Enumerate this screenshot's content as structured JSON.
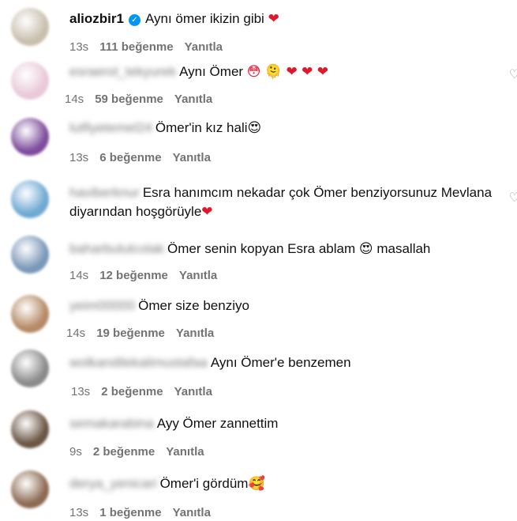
{
  "comments": [
    {
      "username": "aliozbir1",
      "verified": true,
      "blurred": false,
      "text": "Aynı ömer ikizin gibi",
      "emoji": "❤",
      "time": "13s",
      "likes": "111 beğenme",
      "reply": "Yanıtla",
      "avatar_color": "#c9bfae"
    },
    {
      "username": "esraerol_tekyurek",
      "verified": false,
      "blurred": true,
      "text": "Aynı Ömer",
      "emoji": "😳 🫠 ❤ ❤ ❤",
      "time": "14s",
      "likes": "59 beğenme",
      "reply": "Yanıtla",
      "avatar_color": "#e9c9d8"
    },
    {
      "username": "lutfiyetemel24",
      "verified": false,
      "blurred": true,
      "text": "Ömer'in kız hali",
      "emoji": "😍",
      "time": "13s",
      "likes": "6 beğenme",
      "reply": "Yanıtla",
      "avatar_color": "#7d4d9c"
    },
    {
      "username": "haviberknur",
      "verified": false,
      "blurred": true,
      "text": "Esra hanımcım nekadar çok Ömer benziyorsunuz Mevlana diyarından hoşgörüyle",
      "emoji": "❤",
      "time": "",
      "likes": "",
      "reply": "",
      "avatar_color": "#6fa9d3"
    },
    {
      "username": "baharbulutcolak",
      "verified": false,
      "blurred": true,
      "text": "Ömer senin kopyan Esra ablam",
      "emoji": "😍",
      "text2": "masallah",
      "time": "14s",
      "likes": "12 beğenme",
      "reply": "Yanıtla",
      "avatar_color": "#7a98b8"
    },
    {
      "username": "yeim00000",
      "verified": false,
      "blurred": true,
      "text": "Ömer size benziyo",
      "emoji": "",
      "time": "14s",
      "likes": "19 beğenme",
      "reply": "Yanıtla",
      "avatar_color": "#b58a66"
    },
    {
      "username": "wolkandilekalimustafaa",
      "verified": false,
      "blurred": true,
      "text": "Aynı Ömer'e benzemen",
      "emoji": "",
      "time": "13s",
      "likes": "2 beğenme",
      "reply": "Yanıtla",
      "avatar_color": "#8a8a8a"
    },
    {
      "username": "semakarabina",
      "verified": false,
      "blurred": true,
      "text": "Ayy Ömer zannettim",
      "emoji": "",
      "time": "9s",
      "likes": "2 beğenme",
      "reply": "Yanıtla",
      "avatar_color": "#6b5645"
    },
    {
      "username": "derya_yenicari",
      "verified": false,
      "blurred": true,
      "text": "Ömer'i gördüm",
      "emoji": "🥰",
      "time": "13s",
      "likes": "1 beğenme",
      "reply": "Yanıtla",
      "avatar_color": "#8d6a53"
    }
  ]
}
